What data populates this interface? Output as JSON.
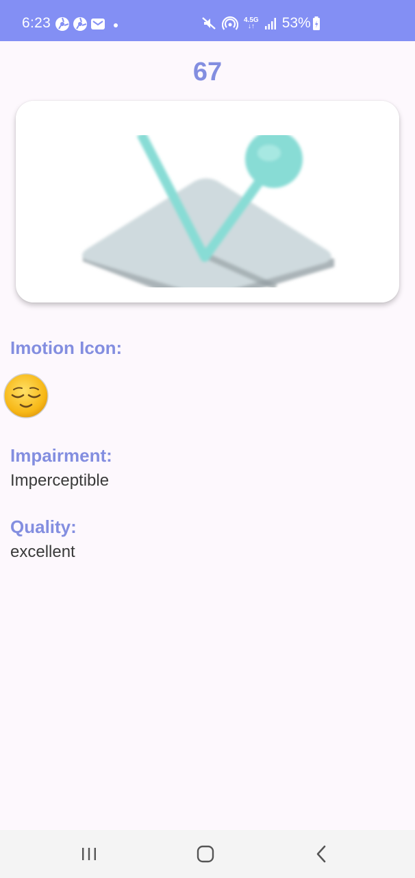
{
  "status_bar": {
    "time": "6:23",
    "network_label_top": "4.5G",
    "network_label_bottom": "↓↑",
    "battery": "53%",
    "accent_color": "#838ff4",
    "icons": [
      "app-notification-icon",
      "app-notification-icon",
      "email-icon",
      "mute-icon",
      "hotspot-icon",
      "signal-icon",
      "battery-icon"
    ]
  },
  "main": {
    "score": "67",
    "image_icon": "motion-sensor-illustration",
    "emotion_label": "Imotion Icon:",
    "emotion_icon": "relieved-face-emoji",
    "impairment_label": "Impairment:",
    "impairment_value": "Imperceptible",
    "quality_label": "Quality:",
    "quality_value": "excellent",
    "label_color": "#838ee0"
  },
  "nav_bar": {
    "icons": [
      "recent-apps-icon",
      "home-icon",
      "back-icon"
    ]
  }
}
